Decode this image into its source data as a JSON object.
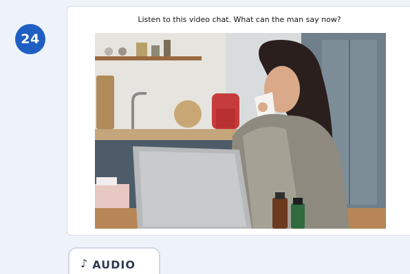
{
  "question": {
    "number": "24",
    "prompt": "Listen to this video chat. What can the man say now?"
  },
  "image": {
    "icon": "photo-woman-sick-laptop"
  },
  "audio_button": {
    "icon": "♪",
    "label": "AUDIO"
  },
  "colors": {
    "badge": "#1f5fc4",
    "panel": "#eef3fa"
  }
}
